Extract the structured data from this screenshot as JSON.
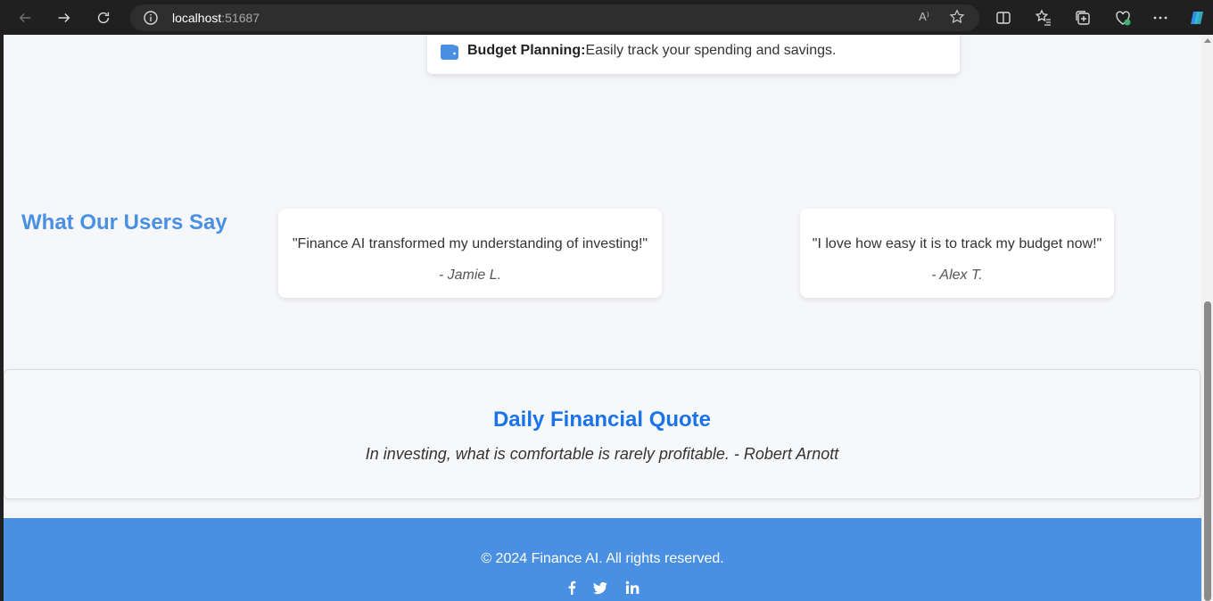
{
  "browser": {
    "url_host": "localhost",
    "url_port": ":51687",
    "read_aloud_label": "A⁾"
  },
  "feature": {
    "title": "Budget Planning:",
    "text": "Easily track your spending and savings."
  },
  "testimonials": {
    "heading": "What Our Users Say",
    "items": [
      {
        "quote": "\"Finance AI transformed my understanding of investing!\"",
        "author": "- Jamie L."
      },
      {
        "quote": "\"I love how easy it is to track my budget now!\"",
        "author": "- Alex T."
      }
    ]
  },
  "daily_quote": {
    "title": "Daily Financial Quote",
    "text": "In investing, what is comfortable is rarely profitable. - Robert Arnott"
  },
  "footer": {
    "copyright": "© 2024 Finance AI. All rights reserved.",
    "social_icons": [
      "facebook-icon",
      "twitter-icon",
      "linkedin-icon"
    ]
  },
  "colors": {
    "accent": "#4a90e2",
    "quote_title": "#1a73e8",
    "chrome_bg": "#202020"
  }
}
